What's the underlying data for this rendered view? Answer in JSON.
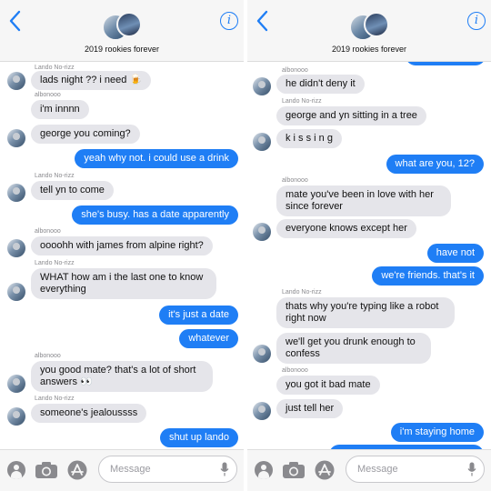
{
  "left": {
    "group_name": "2019 rookies forever",
    "composer_placeholder": "Message",
    "messages": [
      {
        "side": "in",
        "sender": "Lando No-rizz",
        "text": "lads night ?? i need 🍺",
        "avatar": true
      },
      {
        "side": "in",
        "sender": "albonooo",
        "text": "i'm innnn",
        "avatar": false
      },
      {
        "side": "in",
        "sender": "",
        "text": "george you coming?",
        "avatar": true
      },
      {
        "side": "out",
        "text": "yeah why not. i could use a drink"
      },
      {
        "side": "in",
        "sender": "Lando No-rizz",
        "text": "tell yn to come",
        "avatar": true
      },
      {
        "side": "out",
        "text": "she's busy. has a date apparently"
      },
      {
        "side": "in",
        "sender": "albonooo",
        "text": "oooohh with james from alpine right?",
        "avatar": true
      },
      {
        "side": "in",
        "sender": "Lando No-rizz",
        "text": "WHAT how am i the last one to know everything",
        "avatar": true
      },
      {
        "side": "out",
        "text": "it's just a date"
      },
      {
        "side": "out",
        "text": "whatever"
      },
      {
        "side": "in",
        "sender": "albonooo",
        "text": "you good mate? that's a lot of short answers 👀",
        "avatar": true
      },
      {
        "side": "in",
        "sender": "Lando No-rizz",
        "text": "someone's jealoussss",
        "avatar": true
      },
      {
        "side": "out",
        "text": "shut up lando"
      }
    ]
  },
  "right": {
    "group_name": "2019 rookies forever",
    "composer_placeholder": "Message",
    "messages": [
      {
        "side": "in",
        "sender": "albonooo",
        "text": "he didn't deny it",
        "avatar": true
      },
      {
        "side": "in",
        "sender": "Lando No-rizz",
        "text": "george and yn sitting in a tree",
        "avatar": false
      },
      {
        "side": "in",
        "sender": "",
        "text": "k i s s i n g",
        "avatar": true
      },
      {
        "side": "out",
        "text": "what are you, 12?"
      },
      {
        "side": "in",
        "sender": "albonooo",
        "text": "mate you've been in love with her since forever",
        "avatar": false
      },
      {
        "side": "in",
        "sender": "",
        "text": "everyone knows except her",
        "avatar": true
      },
      {
        "side": "out",
        "text": "have not"
      },
      {
        "side": "out",
        "text": "we're friends. that's it"
      },
      {
        "side": "in",
        "sender": "Lando No-rizz",
        "text": "thats why you're typing like a robot right now",
        "avatar": false
      },
      {
        "side": "in",
        "sender": "",
        "text": "we'll get you drunk enough to confess",
        "avatar": true
      },
      {
        "side": "in",
        "sender": "albonooo",
        "text": "you got it bad mate",
        "avatar": false
      },
      {
        "side": "in",
        "sender": "",
        "text": "just tell her",
        "avatar": true
      },
      {
        "side": "out",
        "text": "i'm staying home"
      }
    ]
  }
}
